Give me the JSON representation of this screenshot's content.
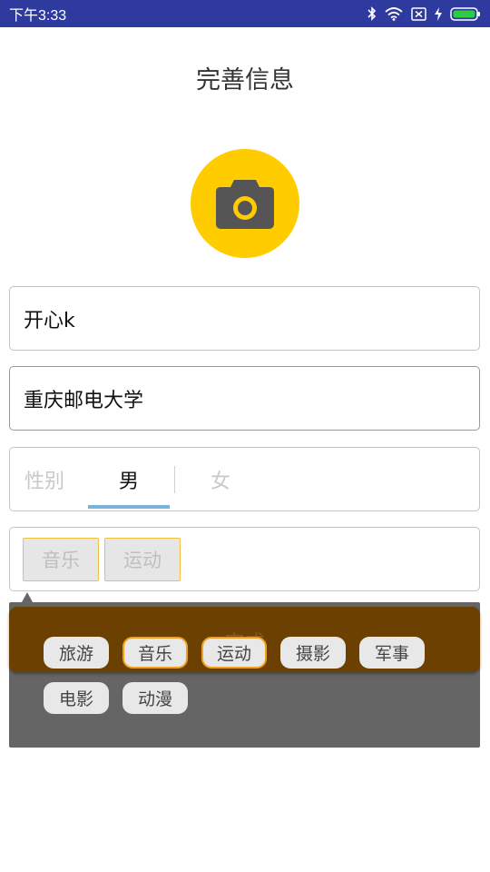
{
  "status_bar": {
    "time": "下午3:33",
    "icons": [
      "bluetooth-icon",
      "wifi-icon",
      "sim-icon",
      "charging-icon",
      "battery-icon"
    ],
    "color": "#2f3a9f"
  },
  "page": {
    "title": "完善信息"
  },
  "avatar": {
    "icon": "camera-icon",
    "color": "#ffcc00"
  },
  "form": {
    "nickname": "开心k",
    "school": "重庆邮电大学",
    "gender": {
      "label": "性别",
      "male": "男",
      "female": "女",
      "selected": "男",
      "indicator_color": "#7ab4dc"
    },
    "hobbies_selected": [
      "音乐",
      "运动"
    ]
  },
  "popup": {
    "done_label": "完成",
    "done_color": "#6b4000",
    "tags": [
      {
        "label": "旅游",
        "selected": false
      },
      {
        "label": "音乐",
        "selected": true
      },
      {
        "label": "运动",
        "selected": true
      },
      {
        "label": "摄影",
        "selected": false
      },
      {
        "label": "军事",
        "selected": false
      },
      {
        "label": "电影",
        "selected": false
      },
      {
        "label": "动漫",
        "selected": false
      }
    ],
    "selected_border_color": "#f0a020"
  }
}
